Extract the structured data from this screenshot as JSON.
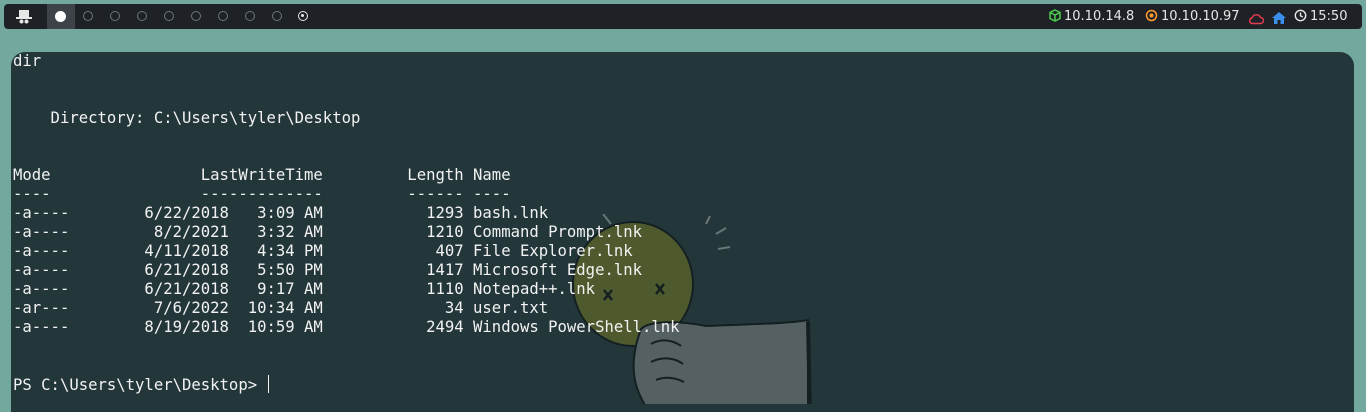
{
  "topbar": {
    "launcher_icon": "hat-icon",
    "workspaces": [
      "active",
      "empty",
      "empty",
      "empty",
      "empty",
      "empty",
      "empty",
      "empty",
      "empty",
      "target"
    ],
    "vpn_ip": "10.10.14.8",
    "target_ip": "10.10.10.97",
    "clock": "15:50",
    "colors": {
      "vpn": "#4ccc4c",
      "target": "#ff9a2e",
      "cloud": "#e23b4e",
      "home": "#3b8eea"
    }
  },
  "terminal": {
    "command": "dir",
    "directory_line": "    Directory: C:\\Users\\tyler\\Desktop",
    "header": "Mode                LastWriteTime         Length Name",
    "underline": "----                -------------         ------ ----",
    "rows": [
      "-a----        6/22/2018   3:09 AM           1293 bash.lnk",
      "-a----         8/2/2021   3:32 AM           1210 Command Prompt.lnk",
      "-a----        4/11/2018   4:34 PM            407 File Explorer.lnk",
      "-a----        6/21/2018   5:50 PM           1417 Microsoft Edge.lnk",
      "-a----        6/21/2018   9:17 AM           1110 Notepad++.lnk",
      "-ar---         7/6/2022  10:34 AM             34 user.txt",
      "-a----        8/19/2018  10:59 AM           2494 Windows PowerShell.lnk"
    ],
    "prompt": "PS C:\\Users\\tyler\\Desktop> "
  }
}
